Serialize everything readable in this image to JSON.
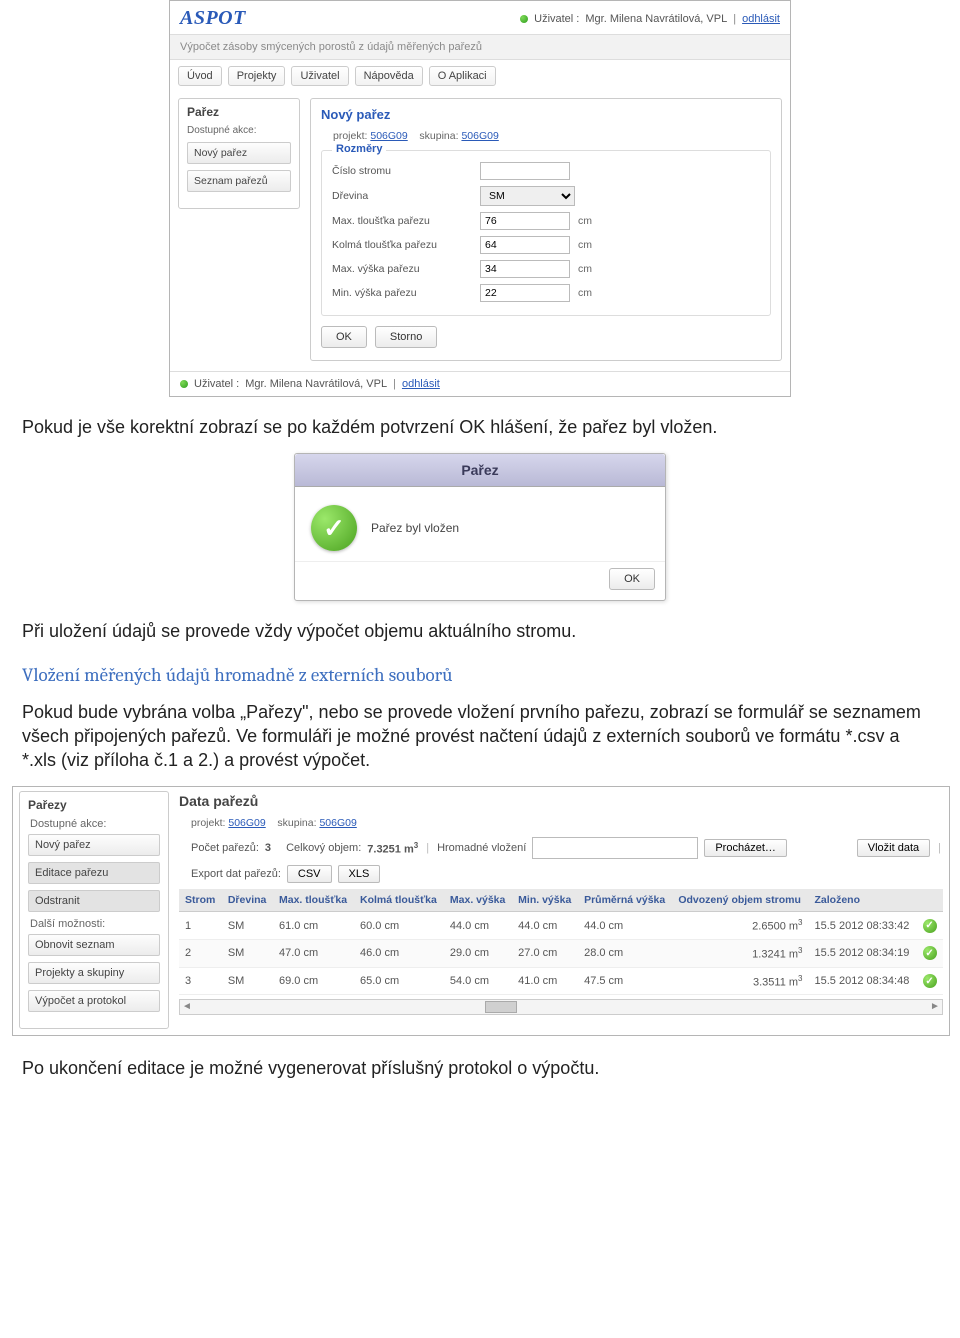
{
  "app1": {
    "logo": "ASPOT",
    "user_prefix": "Uživatel : ",
    "user_name": "Mgr. Milena Navrátilová, VPL",
    "logout": "odhlásit",
    "sub_title": "Výpočet zásoby smýcených porostů z údajů měřených pařezů",
    "menu": [
      "Úvod",
      "Projekty",
      "Uživatel",
      "Nápověda",
      "O Aplikaci"
    ],
    "sidebar": {
      "title": "Pařez",
      "actions_label": "Dostupné akce:",
      "btn_new": "Nový pařez",
      "btn_list": "Seznam pařezů"
    },
    "main": {
      "title": "Nový pařez",
      "proj_label": "projekt:",
      "proj_value": "506G09",
      "grp_label": "skupina:",
      "grp_value": "506G09",
      "legend": "Rozměry",
      "rows": {
        "tree_no": "Číslo stromu",
        "species": "Dřevina",
        "species_val": "SM",
        "max_th": "Max. tloušťka pařezu",
        "max_th_val": "76",
        "perp_th": "Kolmá tloušťka pařezu",
        "perp_th_val": "64",
        "max_h": "Max. výška pařezu",
        "max_h_val": "34",
        "min_h": "Min. výška pařezu",
        "min_h_val": "22",
        "unit": "cm"
      },
      "ok": "OK",
      "cancel": "Storno"
    },
    "footer_user_prefix": "Uživatel : ",
    "footer_user_name": "Mgr. Milena Navrátilová, VPL",
    "footer_logout": "odhlásit"
  },
  "para1": "Pokud je vše korektní zobrazí se po každém potvrzení OK hlášení, že pařez byl vložen.",
  "dialog": {
    "title": "Pařez",
    "msg": "Pařez byl vložen",
    "ok": "OK"
  },
  "para2": "Při uložení údajů se provede vždy výpočet objemu aktuálního stromu.",
  "heading2": "Vložení měřených údajů hromadně z externích souborů",
  "para3": "Pokud bude vybrána volba „Pařezy\", nebo se provede vložení prvního pařezu, zobrazí se formulář se seznamem všech připojených pařezů. Ve formuláři je možné provést načtení údajů z externích souborů ve formátu *.csv a *.xls  (viz příloha č.1 a 2.) a provést výpočet.",
  "app2": {
    "sidebar": {
      "title": "Pařezy",
      "actions_label": "Dostupné akce:",
      "btn_new": "Nový pařez",
      "btn_edit": "Editace pařezu",
      "btn_del": "Odstranit",
      "more_label": "Další možnosti:",
      "btn_refresh": "Obnovit seznam",
      "btn_proj": "Projekty a skupiny",
      "btn_calc": "Výpočet a protokol"
    },
    "main": {
      "title": "Data pařezů",
      "proj_label": "projekt:",
      "proj_value": "506G09",
      "grp_label": "skupina:",
      "grp_value": "506G09",
      "count_label": "Počet pařezů:",
      "count_value": "3",
      "vol_label": "Celkový objem:",
      "vol_value": "7.3251 m",
      "vol_sup": "3",
      "bulk_label": "Hromadné vložení",
      "browse": "Procházet…",
      "insert": "Vložit data",
      "export_label": "Export dat pařezů:",
      "csv": "CSV",
      "xls": "XLS",
      "headers": [
        "Strom",
        "Dřevina",
        "Max. tloušťka",
        "Kolmá tloušťka",
        "Max. výška",
        "Min. výška",
        "Průměrná výška",
        "Odvozený objem stromu",
        "Založeno",
        ""
      ],
      "rows": [
        {
          "c": [
            "1",
            "SM",
            "61.0 cm",
            "60.0 cm",
            "44.0 cm",
            "44.0 cm",
            "44.0 cm",
            "2.6500 m",
            "15.5 2012 08:33:42"
          ]
        },
        {
          "c": [
            "2",
            "SM",
            "47.0 cm",
            "46.0 cm",
            "29.0 cm",
            "27.0 cm",
            "28.0 cm",
            "1.3241 m",
            "15.5 2012 08:34:19"
          ]
        },
        {
          "c": [
            "3",
            "SM",
            "69.0 cm",
            "65.0 cm",
            "54.0 cm",
            "41.0 cm",
            "47.5 cm",
            "3.3511 m",
            "15.5 2012 08:34:48"
          ]
        }
      ]
    }
  },
  "para4": "Po ukončení editace je možné vygenerovat příslušný protokol o výpočtu."
}
